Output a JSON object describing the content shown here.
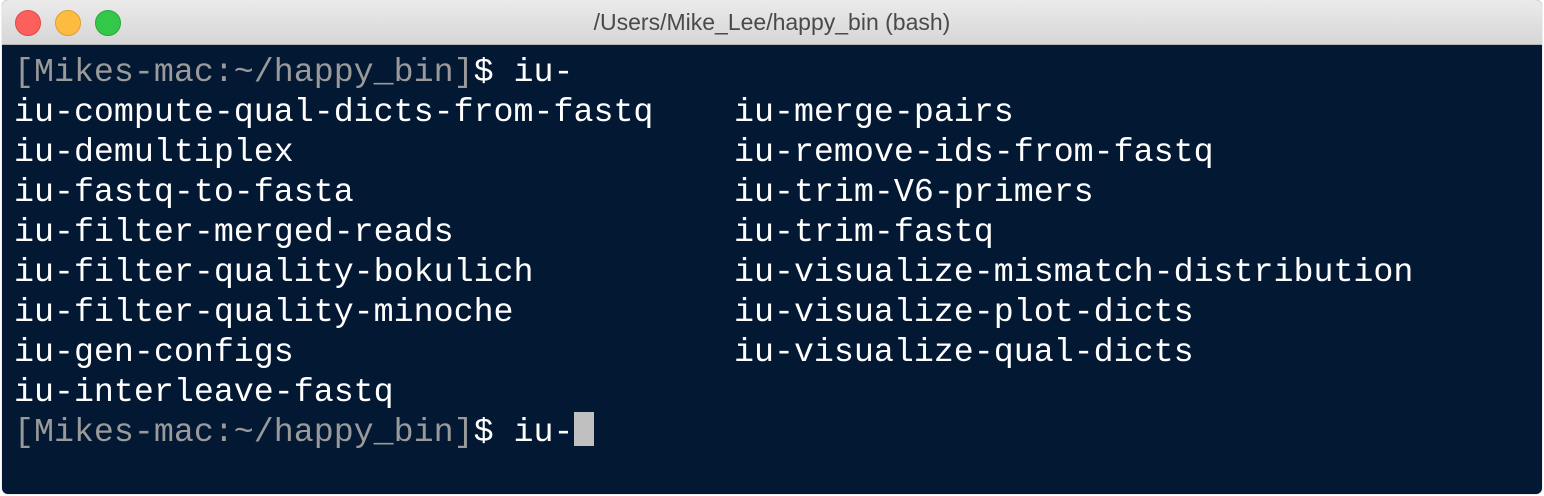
{
  "window": {
    "title": "/Users/Mike_Lee/happy_bin (bash)"
  },
  "colors": {
    "background": "#021833",
    "prompt": "#9a9a9a",
    "text": "#ffffff",
    "close": "#fc605c",
    "minimize": "#fdbc40",
    "zoom": "#34c84a"
  },
  "terminal": {
    "prompt": "[Mikes-mac:~/happy_bin]",
    "dollar": "$ ",
    "command": "iu-",
    "completions_left": [
      "iu-compute-qual-dicts-from-fastq",
      "iu-demultiplex",
      "iu-fastq-to-fasta",
      "iu-filter-merged-reads",
      "iu-filter-quality-bokulich",
      "iu-filter-quality-minoche",
      "iu-gen-configs",
      "iu-interleave-fastq"
    ],
    "completions_right": [
      "iu-merge-pairs",
      "iu-remove-ids-from-fastq",
      "iu-trim-V6-primers",
      "iu-trim-fastq",
      "iu-visualize-mismatch-distribution",
      "iu-visualize-plot-dicts",
      "iu-visualize-qual-dicts"
    ]
  }
}
